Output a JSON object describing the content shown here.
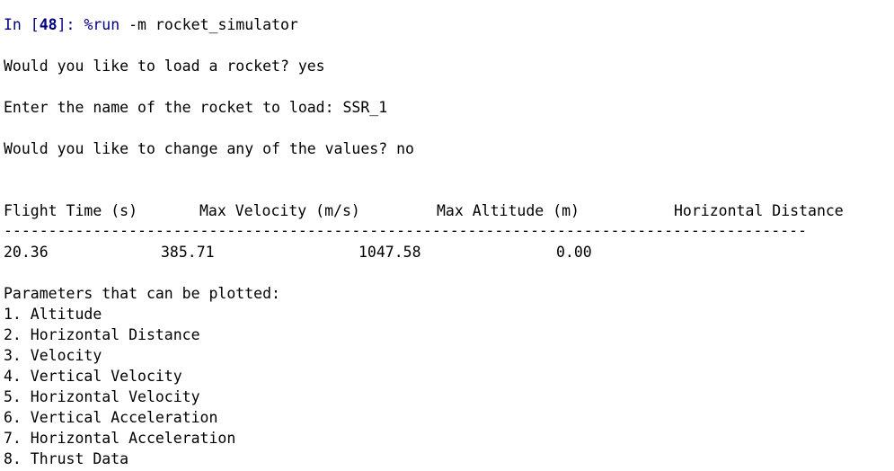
{
  "prompt": {
    "in_label": "In [",
    "number": "48",
    "close": "]: ",
    "magic": "%run",
    "args": " -m rocket_simulator"
  },
  "interaction": {
    "q1": "Would you like to load a rocket? yes",
    "q2": "Enter the name of the rocket to load: SSR_1",
    "q3": "Would you like to change any of the values? no"
  },
  "results_table": {
    "headers": [
      "Flight Time (s)",
      "Max Velocity (m/s)",
      "Max Altitude (m)",
      "Horizontal Distance"
    ],
    "divider": "------------------------------------------------------------------------------------------",
    "row": [
      "20.36",
      "385.71",
      "1047.58",
      "0.00"
    ]
  },
  "plot_menu": {
    "heading": "Parameters that can be plotted:",
    "items": [
      "1. Altitude",
      "2. Horizontal Distance",
      "3. Velocity",
      "4. Vertical Velocity",
      "5. Horizontal Velocity",
      "6. Vertical Acceleration",
      "7. Horizontal Acceleration",
      "8. Thrust Data"
    ]
  }
}
